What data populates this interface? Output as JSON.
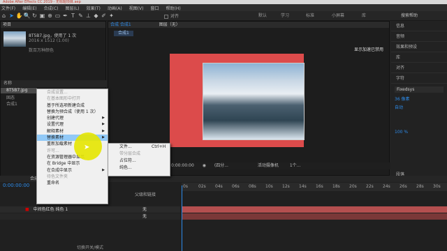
{
  "window": {
    "title": "Adobe After Effects CC 2019 - 无标题项目.aep"
  },
  "menu": [
    "文件(F)",
    "编辑(E)",
    "合成(C)",
    "图层(L)",
    "效果(T)",
    "动画(A)",
    "视图(V)",
    "窗口",
    "帮助(H)"
  ],
  "toolbar": {
    "checkbox_label": "对齐",
    "workspaces": [
      "默认",
      "学习",
      "标准",
      "小屏幕",
      "库"
    ],
    "search_placeholder": "搜索帮助"
  },
  "project": {
    "tab": "项目",
    "file": {
      "name": "8T5B7.jpg",
      "used": "，使用了 1 次",
      "dims": "2016 x 1512 (1.00)",
      "desc": "数百万种颜色"
    },
    "col_name": "名称",
    "items": [
      "8T5B7.jpg",
      "固态",
      "合成1"
    ]
  },
  "comp": {
    "tab": "合成 合成1",
    "layer_tab": "图层（无）",
    "breadcrumb": "合成1",
    "overlay": "显示加速已禁用",
    "bottom": {
      "time": "0:00:00:00",
      "zoom": "(46.2%)",
      "res": "(四分...",
      "camera": "活动摄像机",
      "views": "1个..."
    }
  },
  "context_menu": {
    "items": [
      {
        "label": "合成设置...",
        "dis": true
      },
      {
        "label": "在基本图形中打开",
        "dis": true
      },
      {
        "label": "基于所选项新建合成",
        "dis": false
      },
      {
        "label": "替换为预合成（使用 1 次）",
        "dis": false
      },
      {
        "label": "创建代理",
        "dis": false,
        "sub": true
      },
      {
        "label": "设置代理",
        "dis": false,
        "sub": true
      },
      {
        "label": "解释素材",
        "dis": false,
        "sub": true
      },
      {
        "label": "替换素材",
        "dis": false,
        "sub": true,
        "hl": true
      },
      {
        "label": "重新加载素材",
        "dis": false
      },
      {
        "label": "许可...",
        "dis": true
      },
      {
        "label": "在资源管理器中显示",
        "dis": false
      },
      {
        "label": "在 Bridge 中显示",
        "dis": false
      },
      {
        "label": "在合成中显示",
        "dis": false,
        "sub": true
      },
      {
        "label": "待色文件夹",
        "dis": true
      },
      {
        "label": "重命名",
        "dis": false
      }
    ]
  },
  "submenu": {
    "items": [
      {
        "label": "文件...",
        "shortcut": "Ctrl+H"
      },
      {
        "label": "带分层合成",
        "shortcut": ""
      },
      {
        "label": "占位符...",
        "shortcut": ""
      },
      {
        "label": "纯色...",
        "shortcut": ""
      }
    ]
  },
  "timeline": {
    "tab": "合成1",
    "time": "0:00:00:00",
    "ruler": [
      "0s",
      "02s",
      "04s",
      "06s",
      "08s",
      "10s",
      "12s",
      "14s",
      "16s",
      "18s",
      "20s",
      "22s",
      "24s",
      "26s",
      "28s",
      "30s"
    ],
    "col_parent": "父级和链接",
    "layers": [
      {
        "num": "1",
        "name": "中间色红色 纯色 1",
        "parent": "无"
      },
      {
        "num": "2",
        "name": "",
        "parent": "无"
      }
    ],
    "footer": "切换开关/模式"
  },
  "right_panel": {
    "items": [
      "信息",
      "音频",
      "效果和预设",
      "库",
      "对齐",
      "字符"
    ],
    "font": "Fixedsys",
    "size": "36 像素",
    "leading": "自动",
    "tracking": "100 %",
    "paragraph": "段落"
  }
}
